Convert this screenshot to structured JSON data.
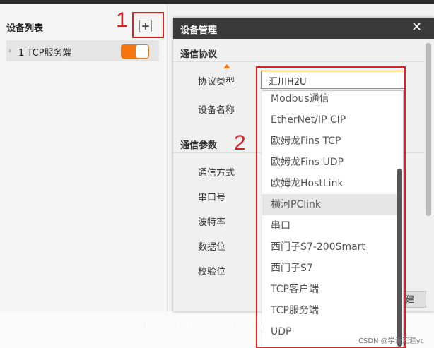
{
  "left_panel": {
    "title": "设备列表",
    "add_label": "+",
    "device": {
      "chevron": "›",
      "label": "1 TCP服务端",
      "enabled": true
    }
  },
  "dialog": {
    "title": "设备管理",
    "close": "✕",
    "section_protocol": "通信协议",
    "protocol_type_label": "协议类型",
    "protocol_type_value": "汇川H2U",
    "device_name_label": "设备名称",
    "section_params": "通信参数",
    "params_labels": [
      "通信方式",
      "串口号",
      "波特率",
      "数据位",
      "校验位"
    ],
    "footer_button": "建"
  },
  "dropdown": {
    "options": [
      "Modbus通信",
      "EtherNet/IP CIP",
      "欧姆龙Fins TCP",
      "欧姆龙Fins UDP",
      "欧姆龙HostLink",
      "横河PClink",
      "串口",
      "西门子S7-200Smart",
      "西门子S7",
      "TCP客户端",
      "TCP服务端",
      "UDP"
    ],
    "highlighted_index": 5
  },
  "annotations": {
    "one": "1",
    "two": "2"
  },
  "watermark": "xaiocaimozhouxi Vision",
  "credit": "CSDN @学海无涯yc",
  "colors": {
    "accent": "#f7750f",
    "annotation": "#e02020",
    "header": "#3a3a3a"
  }
}
